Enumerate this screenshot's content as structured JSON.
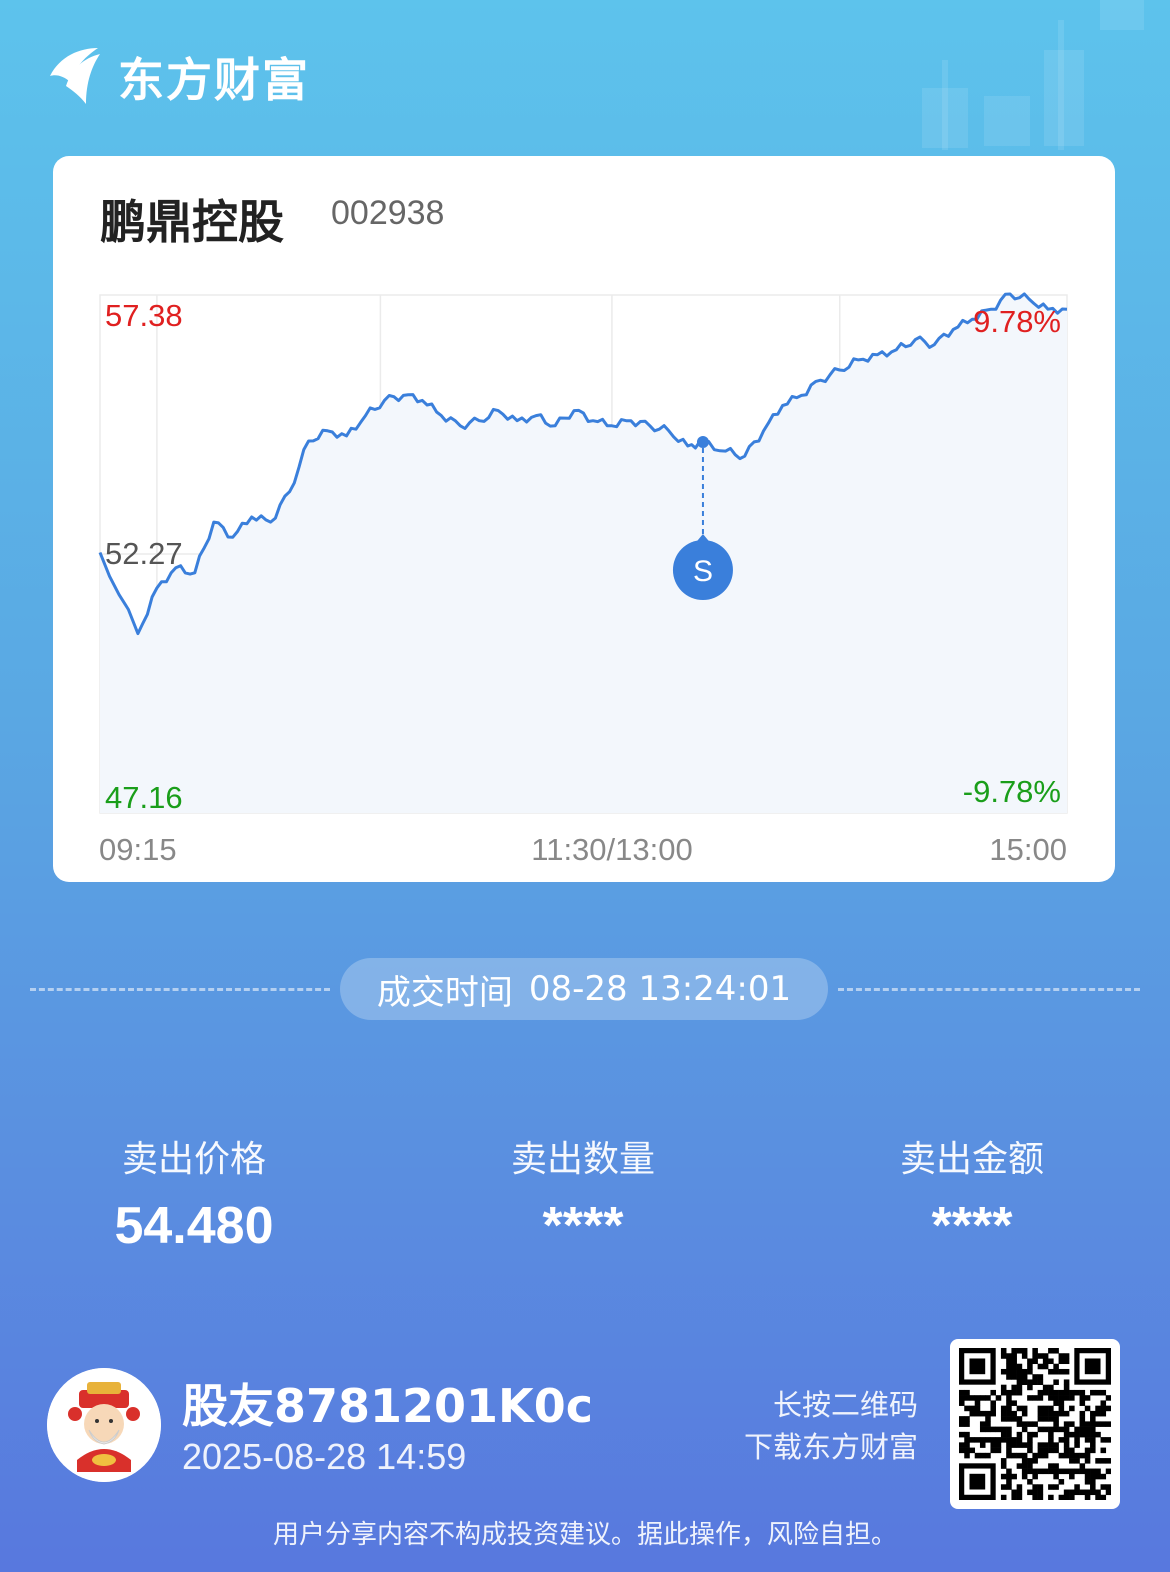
{
  "brand": {
    "name": "东方财富",
    "logo_icon": "eastmoney-logo-icon"
  },
  "stock": {
    "name": "鹏鼎控股",
    "code": "002938"
  },
  "chart_data": {
    "type": "line",
    "x_ticks": [
      "09:15",
      "11:30/13:00",
      "15:00"
    ],
    "price_labels": {
      "high": "57.38",
      "mid": "52.27",
      "low": "47.16"
    },
    "pct_labels": {
      "high": "9.78%",
      "low": "-9.78%"
    },
    "ylim": [
      47.16,
      57.38
    ],
    "prev_close": 52.27,
    "line_color": "#3a7fdb",
    "up_color": "#e02020",
    "down_color": "#1a9e1a",
    "series": [
      {
        "x": [
          "09:15",
          "09:25",
          "09:30",
          "09:35",
          "09:40",
          "09:45",
          "09:50",
          "09:55",
          "10:00",
          "10:05",
          "10:10",
          "10:15",
          "10:20",
          "10:25",
          "10:30",
          "10:35",
          "10:40",
          "10:45",
          "10:50",
          "10:55",
          "11:00",
          "11:05",
          "11:10",
          "11:15",
          "11:20",
          "11:25",
          "11:30",
          "13:05",
          "13:10",
          "13:15",
          "13:20",
          "13:24",
          "13:30",
          "13:35",
          "13:40",
          "13:45",
          "13:50",
          "13:55",
          "14:00",
          "14:05",
          "14:10",
          "14:15",
          "14:20",
          "14:25",
          "14:30",
          "14:35",
          "14:40",
          "14:45",
          "14:50",
          "14:55",
          "15:00"
        ],
        "values": [
          52.3,
          50.7,
          51.6,
          52.0,
          51.9,
          52.9,
          52.6,
          53.0,
          52.9,
          53.5,
          54.5,
          54.7,
          54.6,
          55.0,
          55.3,
          55.4,
          55.3,
          55.0,
          54.8,
          54.9,
          55.1,
          54.9,
          55.0,
          54.8,
          55.1,
          54.9,
          54.8,
          54.9,
          54.8,
          54.7,
          54.4,
          54.48,
          54.3,
          54.2,
          54.7,
          55.2,
          55.4,
          55.7,
          55.9,
          56.1,
          56.2,
          56.3,
          56.5,
          56.4,
          56.7,
          56.9,
          57.1,
          57.4,
          57.3,
          57.1,
          57.1
        ]
      }
    ],
    "trade_marker": {
      "x": "13:24",
      "value": 54.48,
      "label": "S"
    }
  },
  "trade": {
    "time_label": "成交时间",
    "time_value": "08-28 13:24:01"
  },
  "stats": [
    {
      "label": "卖出价格",
      "value": "54.480"
    },
    {
      "label": "卖出数量",
      "value": "****"
    },
    {
      "label": "卖出金额",
      "value": "****"
    }
  ],
  "user": {
    "name": "股友8781201K0c",
    "date": "2025-08-28 14:59",
    "avatar_icon": "god-of-wealth-avatar-icon"
  },
  "qr": {
    "hint_line1": "长按二维码",
    "hint_line2": "下载东方财富",
    "icon": "qr-code-icon"
  },
  "disclaimer": "用户分享内容不构成投资建议。据此操作，风险自担。"
}
